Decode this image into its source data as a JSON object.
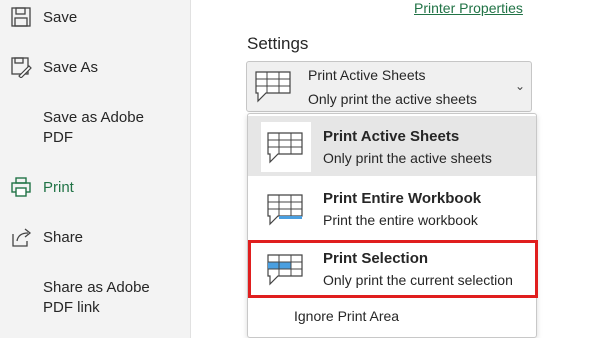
{
  "nav": {
    "items": [
      {
        "label": "Save",
        "icon": "save-icon"
      },
      {
        "label": "Save As",
        "icon": "save-as-icon"
      },
      {
        "label": "Save as Adobe\nPDF",
        "icon": ""
      },
      {
        "label": "Print",
        "icon": "print-icon"
      },
      {
        "label": "Share",
        "icon": "share-icon"
      },
      {
        "label": "Share as Adobe\nPDF link",
        "icon": ""
      }
    ],
    "active_color": "#217346"
  },
  "printer_properties": "Printer Properties",
  "settings": {
    "title": "Settings",
    "selected": {
      "title": "Print Active Sheets",
      "description": "Only print the active sheets"
    },
    "options": [
      {
        "title": "Print Active Sheets",
        "description": "Only print the active sheets",
        "icon": "active-sheets-icon"
      },
      {
        "title": "Print Entire Workbook",
        "description": "Print the entire workbook",
        "icon": "entire-workbook-icon"
      },
      {
        "title": "Print Selection",
        "description": "Only print the current selection",
        "icon": "selection-icon"
      }
    ],
    "ignore_print_area": "Ignore Print Area"
  },
  "colors": {
    "accent_green": "#217346",
    "highlight_red": "#e01e1e",
    "selection_blue": "#4a9fe0"
  }
}
